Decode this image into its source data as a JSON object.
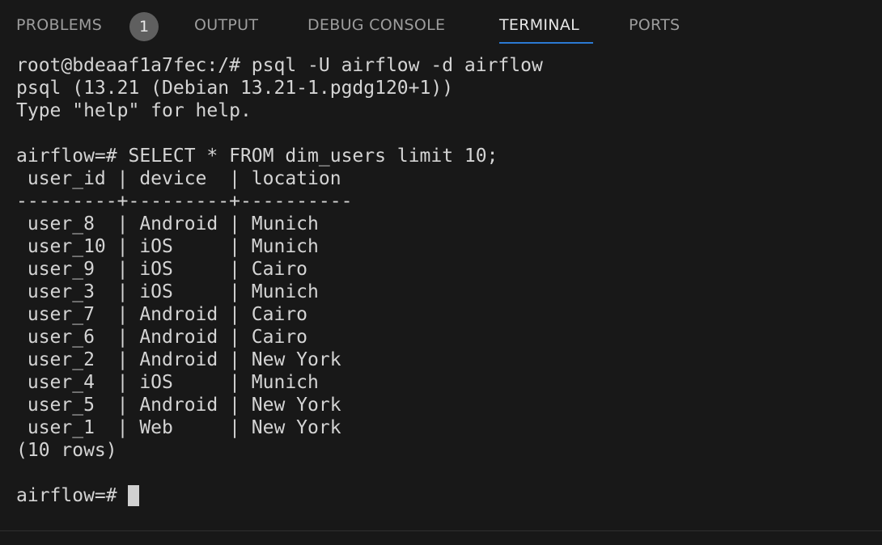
{
  "tabs": {
    "problems": "PROBLEMS",
    "problems_count": "1",
    "output": "OUTPUT",
    "debug_console": "DEBUG CONSOLE",
    "terminal": "TERMINAL",
    "ports": "PORTS",
    "active": "TERMINAL"
  },
  "terminal": {
    "lines": [
      "root@bdeaaf1a7fec:/# psql -U airflow -d airflow",
      "psql (13.21 (Debian 13.21-1.pgdg120+1))",
      "Type \"help\" for help.",
      "",
      "airflow=# SELECT * FROM dim_users limit 10;",
      " user_id | device  | location",
      "---------+---------+----------",
      " user_8  | Android | Munich",
      " user_10 | iOS     | Munich",
      " user_9  | iOS     | Cairo",
      " user_3  | iOS     | Munich",
      " user_7  | Android | Cairo",
      " user_6  | Android | Cairo",
      " user_2  | Android | New York",
      " user_4  | iOS     | Munich",
      " user_5  | Android | New York",
      " user_1  | Web     | New York",
      "(10 rows)",
      ""
    ],
    "prompt": "airflow=# "
  }
}
